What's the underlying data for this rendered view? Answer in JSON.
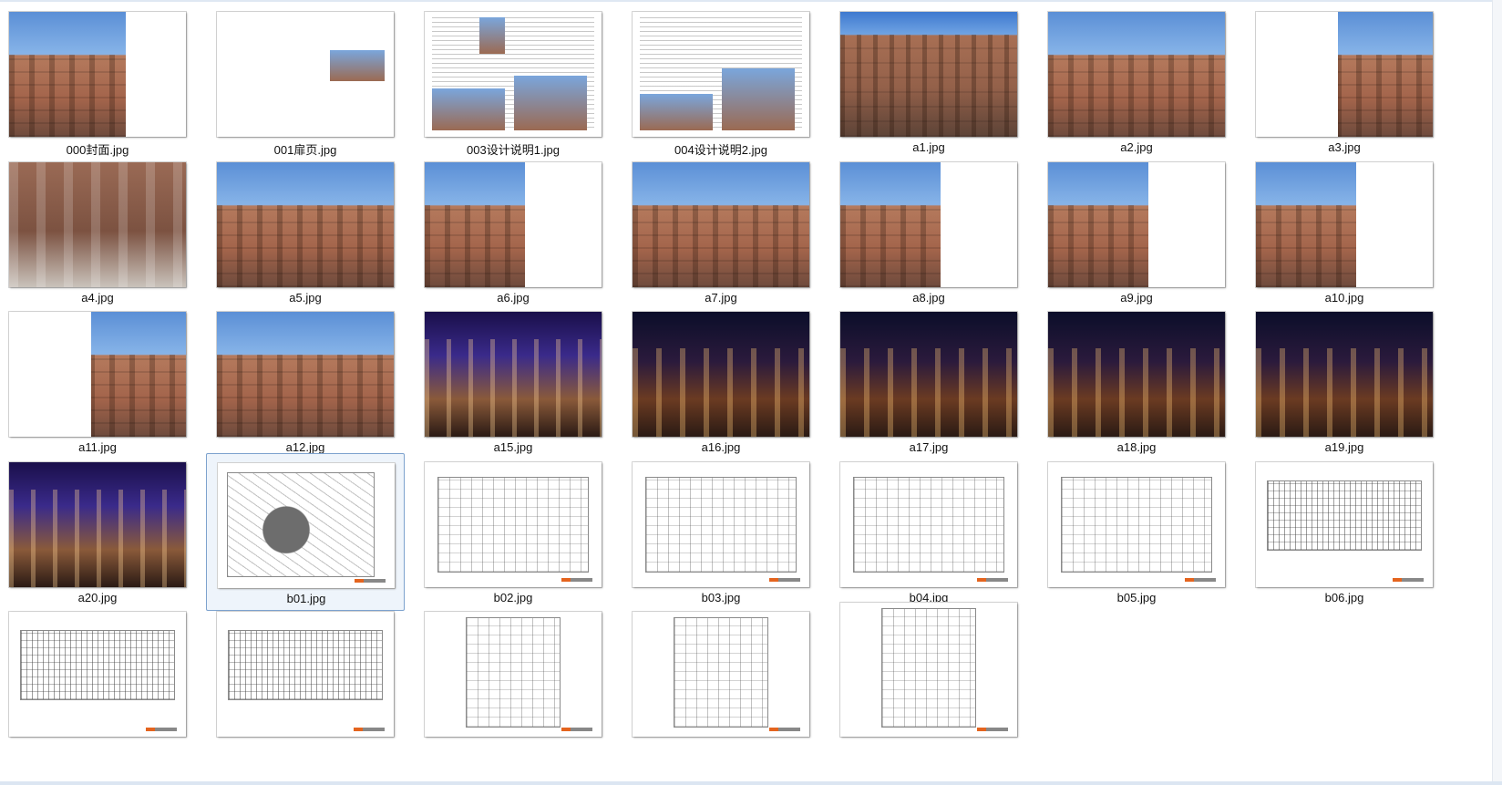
{
  "files": [
    {
      "name": "000封面.jpg",
      "kind": "k-brick",
      "variant": "cover"
    },
    {
      "name": "001扉页.jpg",
      "kind": "k-white",
      "variant": "title"
    },
    {
      "name": "003设计说明1.jpg",
      "kind": "k-white",
      "variant": "text1"
    },
    {
      "name": "004设计说明2.jpg",
      "kind": "k-white",
      "variant": "text2"
    },
    {
      "name": "a1.jpg",
      "kind": "k-brick-tall",
      "variant": "photo"
    },
    {
      "name": "a2.jpg",
      "kind": "k-brick",
      "variant": "photo"
    },
    {
      "name": "a3.jpg",
      "kind": "k-brick",
      "variant": "rightphoto"
    },
    {
      "name": "a4.jpg",
      "kind": "k-arcade",
      "variant": "photo"
    },
    {
      "name": "a5.jpg",
      "kind": "k-brick",
      "variant": "photo"
    },
    {
      "name": "a6.jpg",
      "kind": "k-brick",
      "variant": "leftphoto"
    },
    {
      "name": "a7.jpg",
      "kind": "k-brick",
      "variant": "photo"
    },
    {
      "name": "a8.jpg",
      "kind": "k-brick",
      "variant": "leftphoto"
    },
    {
      "name": "a9.jpg",
      "kind": "k-brick",
      "variant": "leftphoto"
    },
    {
      "name": "a10.jpg",
      "kind": "k-brick",
      "variant": "leftphoto"
    },
    {
      "name": "a11.jpg",
      "kind": "k-brick",
      "variant": "rightphoto"
    },
    {
      "name": "a12.jpg",
      "kind": "k-brick",
      "variant": "photo"
    },
    {
      "name": "a15.jpg",
      "kind": "k-night-purple",
      "variant": "photo"
    },
    {
      "name": "a16.jpg",
      "kind": "k-night",
      "variant": "photo"
    },
    {
      "name": "a17.jpg",
      "kind": "k-night",
      "variant": "photo"
    },
    {
      "name": "a18.jpg",
      "kind": "k-night",
      "variant": "photo"
    },
    {
      "name": "a19.jpg",
      "kind": "k-night",
      "variant": "photo"
    },
    {
      "name": "a20.jpg",
      "kind": "k-night-purple",
      "variant": "photo"
    },
    {
      "name": "b01.jpg",
      "kind": "k-white",
      "variant": "site",
      "selected": true
    },
    {
      "name": "b02.jpg",
      "kind": "k-white",
      "variant": "plan"
    },
    {
      "name": "b03.jpg",
      "kind": "k-white",
      "variant": "plan"
    },
    {
      "name": "b04.jpg",
      "kind": "k-white",
      "variant": "plan"
    },
    {
      "name": "b05.jpg",
      "kind": "k-white",
      "variant": "plan"
    },
    {
      "name": "b06.jpg",
      "kind": "k-white",
      "variant": "elev"
    },
    {
      "name": "",
      "kind": "k-white",
      "variant": "elev"
    },
    {
      "name": "",
      "kind": "k-white",
      "variant": "elev"
    },
    {
      "name": "",
      "kind": "k-white",
      "variant": "tallplan"
    },
    {
      "name": "",
      "kind": "k-white",
      "variant": "tallplan"
    },
    {
      "name": "",
      "kind": "k-white",
      "variant": "tallplan"
    }
  ],
  "colors": {
    "selection_border": "#7da2ce",
    "selection_fill": "#eef4fb",
    "logo_orange": "#e4641e"
  }
}
